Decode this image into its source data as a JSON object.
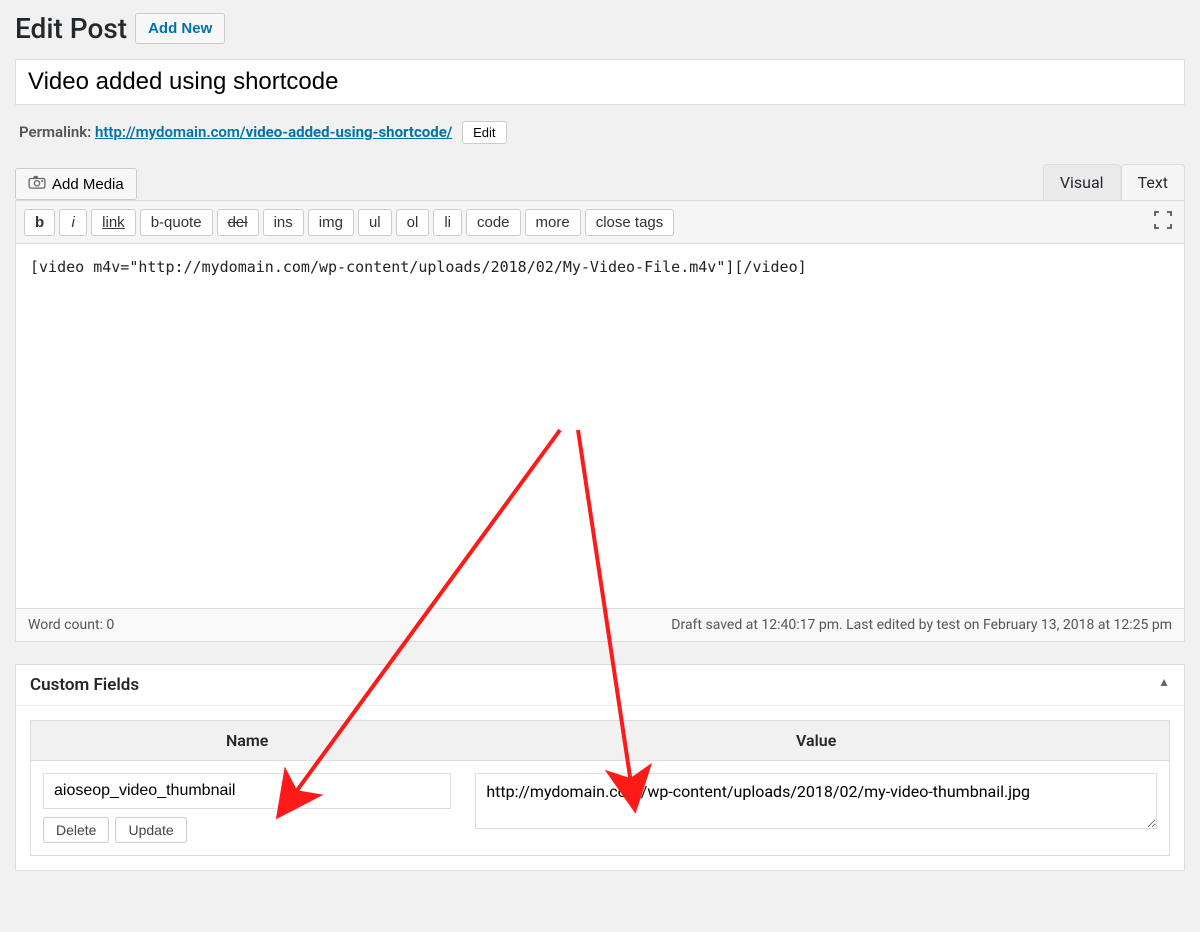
{
  "header": {
    "page_title": "Edit Post",
    "add_new_label": "Add New"
  },
  "title_field": {
    "value": "Video added using shortcode"
  },
  "permalink": {
    "label": "Permalink:",
    "base_url": "http://mydomain.com/",
    "slug": "video-added-using-shortcode/",
    "edit_label": "Edit"
  },
  "media": {
    "add_media_label": "Add Media"
  },
  "tabs": {
    "visual": "Visual",
    "text": "Text"
  },
  "toolbar": {
    "b": "b",
    "i": "i",
    "link": "link",
    "bquote": "b-quote",
    "del": "del",
    "ins": "ins",
    "img": "img",
    "ul": "ul",
    "ol": "ol",
    "li": "li",
    "code": "code",
    "more": "more",
    "close": "close tags"
  },
  "editor": {
    "content": "[video m4v=\"http://mydomain.com/wp-content/uploads/2018/02/My-Video-File.m4v\"][/video]"
  },
  "footer": {
    "word_count_label": "Word count: 0",
    "status": "Draft saved at 12:40:17 pm. Last edited by test on February 13, 2018 at 12:25 pm"
  },
  "custom_fields": {
    "panel_title": "Custom Fields",
    "name_header": "Name",
    "value_header": "Value",
    "rows": [
      {
        "name": "aioseop_video_thumbnail",
        "value": "http://mydomain.com/wp-content/uploads/2018/02/my-video-thumbnail.jpg"
      }
    ],
    "delete_label": "Delete",
    "update_label": "Update"
  }
}
